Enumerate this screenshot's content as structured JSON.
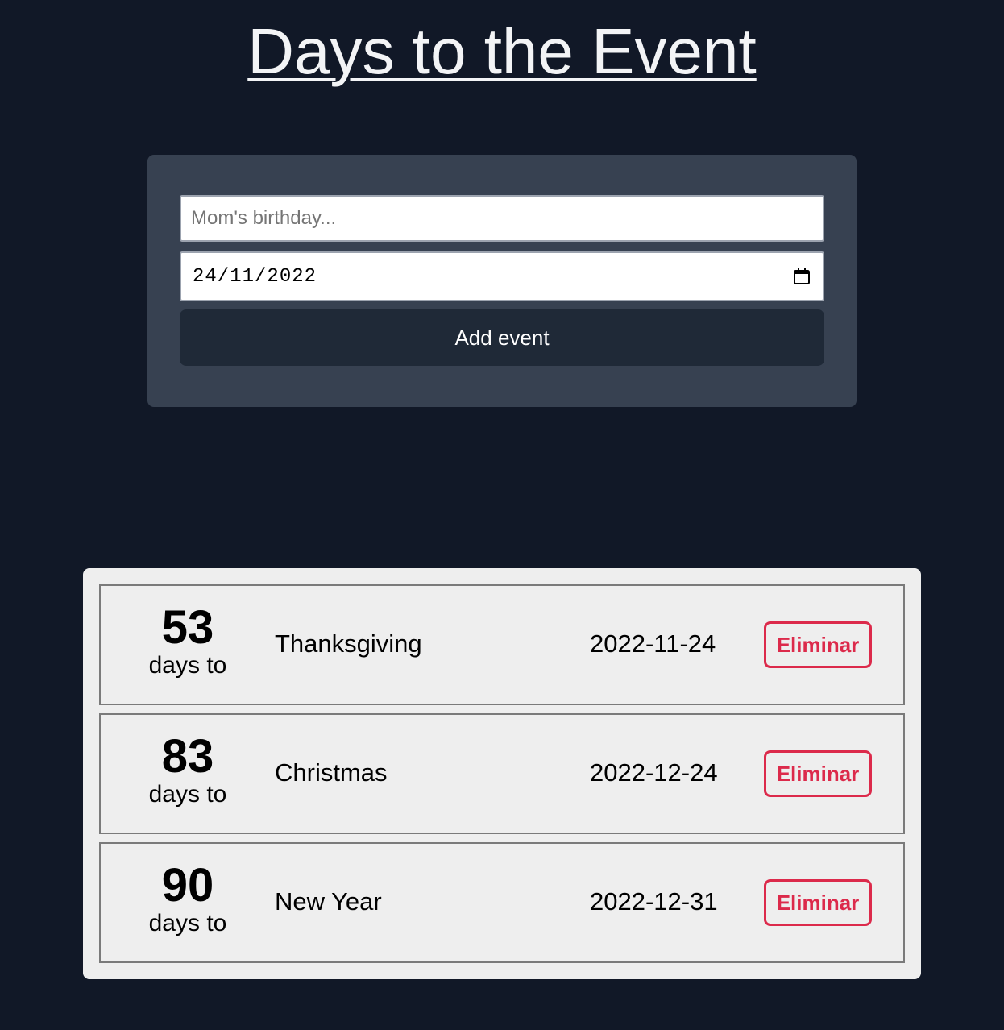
{
  "header": {
    "title": "Days to the Event"
  },
  "form": {
    "name_placeholder": "Mom's birthday...",
    "name_value": "",
    "date_value": "24/11/2022",
    "calendar_icon": "calendar-icon",
    "add_label": "Add event"
  },
  "events": [
    {
      "days": "53",
      "days_label": "days to",
      "name": "Thanksgiving",
      "date": "2022-11-24",
      "delete_label": "Eliminar"
    },
    {
      "days": "83",
      "days_label": "days to",
      "name": "Christmas",
      "date": "2022-12-24",
      "delete_label": "Eliminar"
    },
    {
      "days": "90",
      "days_label": "days to",
      "name": "New Year",
      "date": "2022-12-31",
      "delete_label": "Eliminar"
    }
  ],
  "colors": {
    "background": "#111827",
    "panel": "#374151",
    "button": "#1f2937",
    "list_background": "#eeeeee",
    "danger": "#dc2a4b"
  }
}
